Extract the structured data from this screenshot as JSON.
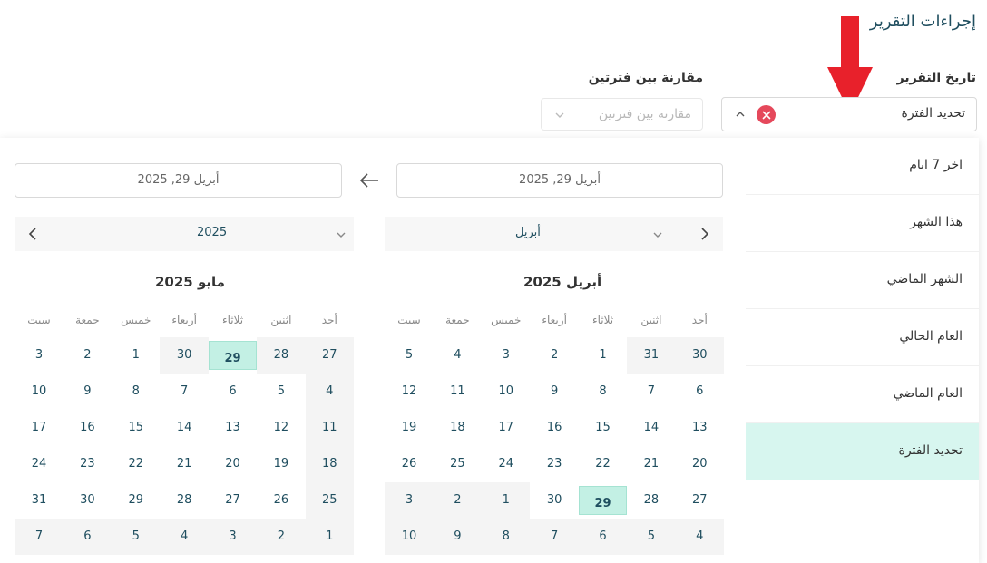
{
  "header": {
    "title": "إجراءات التقرير"
  },
  "report_date": {
    "label": "تاريخ التقرير",
    "value": "تحديد الفترة"
  },
  "compare": {
    "label": "مقارنة بين فترتين",
    "placeholder": "مقارنة بين فترتين"
  },
  "presets": [
    {
      "label": "اخر 7 ايام",
      "active": false
    },
    {
      "label": "هذا الشهر",
      "active": false
    },
    {
      "label": "الشهر الماضي",
      "active": false
    },
    {
      "label": "العام الحالي",
      "active": false
    },
    {
      "label": "العام الماضي",
      "active": false
    },
    {
      "label": "تحديد الفترة",
      "active": true
    }
  ],
  "range": {
    "start": "أبريل 29, 2025",
    "end": "أبريل 29, 2025"
  },
  "left_nav": {
    "selected": "أبريل"
  },
  "right_nav": {
    "selected": "2025"
  },
  "weekdays": [
    "أحد",
    "اثنين",
    "ثلاثاء",
    "أربعاء",
    "خميس",
    "جمعة",
    "سبت"
  ],
  "calendars": [
    {
      "title": "أبريل 2025",
      "weeks": [
        [
          {
            "d": "30",
            "out": true
          },
          {
            "d": "31",
            "out": true
          },
          {
            "d": "1"
          },
          {
            "d": "2"
          },
          {
            "d": "3"
          },
          {
            "d": "4"
          },
          {
            "d": "5"
          }
        ],
        [
          {
            "d": "6"
          },
          {
            "d": "7"
          },
          {
            "d": "8"
          },
          {
            "d": "9"
          },
          {
            "d": "10"
          },
          {
            "d": "11"
          },
          {
            "d": "12"
          }
        ],
        [
          {
            "d": "13"
          },
          {
            "d": "14"
          },
          {
            "d": "15"
          },
          {
            "d": "16"
          },
          {
            "d": "17"
          },
          {
            "d": "18"
          },
          {
            "d": "19"
          }
        ],
        [
          {
            "d": "20"
          },
          {
            "d": "21"
          },
          {
            "d": "22"
          },
          {
            "d": "23"
          },
          {
            "d": "24"
          },
          {
            "d": "25"
          },
          {
            "d": "26"
          }
        ],
        [
          {
            "d": "27"
          },
          {
            "d": "28"
          },
          {
            "d": "29",
            "sel": true
          },
          {
            "d": "30"
          },
          {
            "d": "1",
            "out": true
          },
          {
            "d": "2",
            "out": true
          },
          {
            "d": "3",
            "out": true
          }
        ],
        [
          {
            "d": "4",
            "out": true
          },
          {
            "d": "5",
            "out": true
          },
          {
            "d": "6",
            "out": true
          },
          {
            "d": "7",
            "out": true
          },
          {
            "d": "8",
            "out": true
          },
          {
            "d": "9",
            "out": true
          },
          {
            "d": "10",
            "out": true
          }
        ]
      ]
    },
    {
      "title": "مايو 2025",
      "weeks": [
        [
          {
            "d": "27",
            "out": true
          },
          {
            "d": "28",
            "out": true
          },
          {
            "d": "29",
            "out": true,
            "sel": true
          },
          {
            "d": "30",
            "out": true
          },
          {
            "d": "1"
          },
          {
            "d": "2"
          },
          {
            "d": "3"
          }
        ],
        [
          {
            "d": "4",
            "out": true
          },
          {
            "d": "5"
          },
          {
            "d": "6"
          },
          {
            "d": "7"
          },
          {
            "d": "8"
          },
          {
            "d": "9"
          },
          {
            "d": "10"
          }
        ],
        [
          {
            "d": "11",
            "out": true
          },
          {
            "d": "12"
          },
          {
            "d": "13"
          },
          {
            "d": "14"
          },
          {
            "d": "15"
          },
          {
            "d": "16"
          },
          {
            "d": "17"
          }
        ],
        [
          {
            "d": "18",
            "out": true
          },
          {
            "d": "19"
          },
          {
            "d": "20"
          },
          {
            "d": "21"
          },
          {
            "d": "22"
          },
          {
            "d": "23"
          },
          {
            "d": "24"
          }
        ],
        [
          {
            "d": "25",
            "out": true
          },
          {
            "d": "26"
          },
          {
            "d": "27"
          },
          {
            "d": "28"
          },
          {
            "d": "29"
          },
          {
            "d": "30"
          },
          {
            "d": "31"
          }
        ],
        [
          {
            "d": "1",
            "out": true
          },
          {
            "d": "2",
            "out": true
          },
          {
            "d": "3",
            "out": true
          },
          {
            "d": "4",
            "out": true
          },
          {
            "d": "5",
            "out": true
          },
          {
            "d": "6",
            "out": true
          },
          {
            "d": "7",
            "out": true
          }
        ]
      ]
    }
  ],
  "colors": {
    "accent": "#1f4e5f",
    "selected_bg": "#c3f0e4",
    "active_preset_bg": "#d7f6ef",
    "clear_button": "#e5485b",
    "annotation_arrow": "#e8212b"
  },
  "icons": {
    "clear": "close-icon",
    "period_toggle": "chevron-up-icon",
    "compare_toggle": "chevron-down-icon",
    "range_separator": "arrow-left-icon",
    "prev_month": "chevron-right-icon",
    "next_month": "chevron-left-icon"
  }
}
